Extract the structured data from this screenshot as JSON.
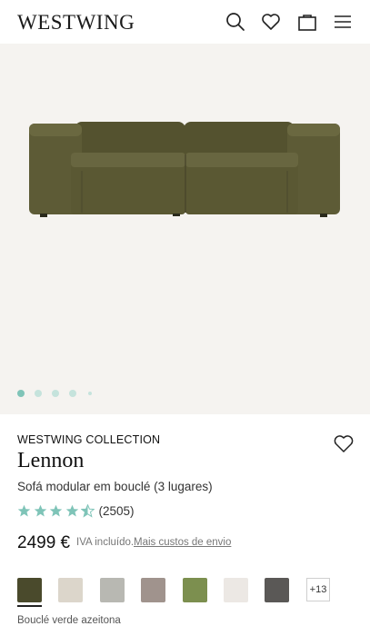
{
  "header": {
    "logo": "WESTWING",
    "icons": [
      "search-icon",
      "heart-icon",
      "bag-icon",
      "menu-icon"
    ]
  },
  "gallery": {
    "image": "olive-green-modular-sofa",
    "dots_count": 5,
    "active_dot": 1
  },
  "product": {
    "brand": "WESTWING COLLECTION",
    "name": "Lennon",
    "subtitle": "Sofá modular em bouclé (3 lugares)",
    "rating": 4.5,
    "rating_count": "(2505)",
    "price": "2499 €",
    "vat": "IVA incluído.",
    "shipping_link": "Mais custos de envio"
  },
  "colors": {
    "swatches": [
      {
        "name": "verde-azeitona",
        "color": "#4a4a2c"
      },
      {
        "name": "creme",
        "color": "#dcd6cb"
      },
      {
        "name": "cinzento",
        "color": "#b8b8b2"
      },
      {
        "name": "taupe",
        "color": "#a0938d"
      },
      {
        "name": "verde",
        "color": "#7c8f4f"
      },
      {
        "name": "branco",
        "color": "#ece8e4"
      },
      {
        "name": "antracite",
        "color": "#5a5856"
      }
    ],
    "more": "+13",
    "selected_label": "Bouclé verde azeitona"
  },
  "theme": {
    "accent": "#7fc4b8",
    "sofa": "#5c5a35"
  }
}
